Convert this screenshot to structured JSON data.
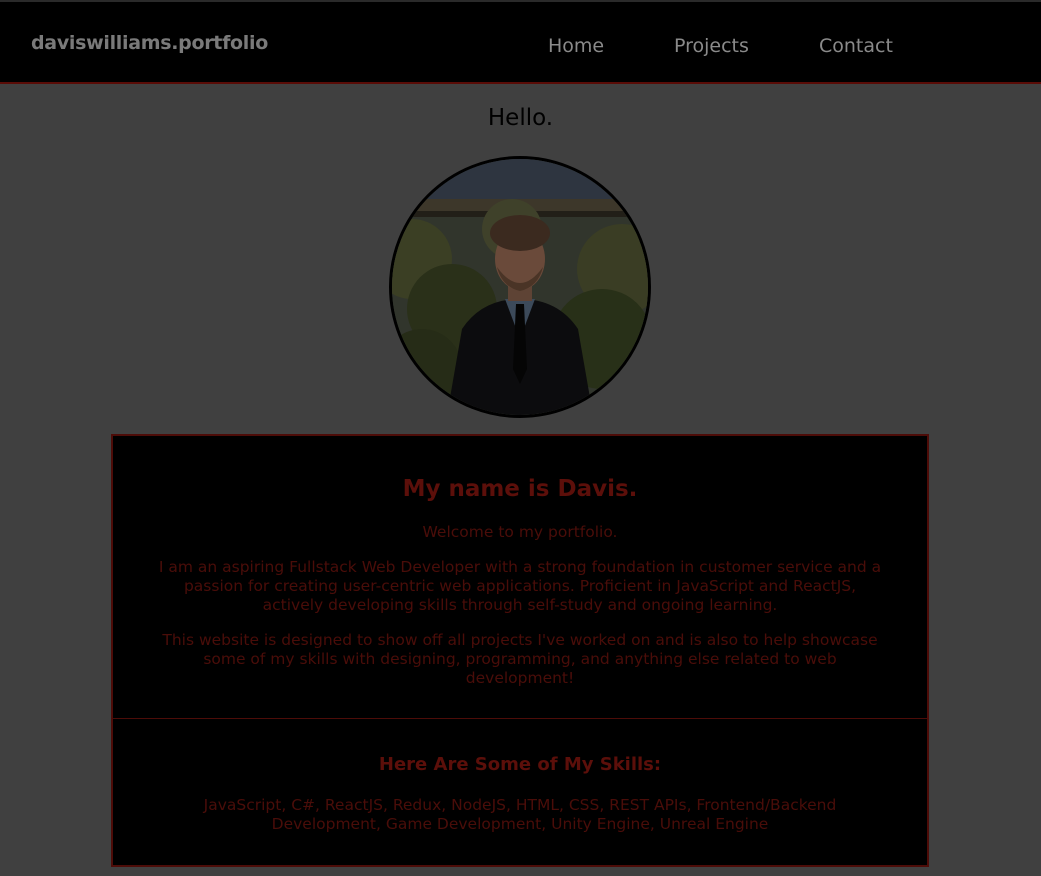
{
  "navbar": {
    "brand": "daviswilliams.portfolio",
    "links": [
      "Home",
      "Projects",
      "Contact"
    ]
  },
  "hero": {
    "greeting": "Hello."
  },
  "about": {
    "title": "My name is Davis.",
    "welcome": "Welcome to my portfolio.",
    "paragraph1": "I am an aspiring Fullstack Web Developer with a strong foundation in customer service and a passion for creating user-centric web applications. Proficient in JavaScript and ReactJS, actively developing skills through self-study and ongoing learning.",
    "paragraph2": "This website is designed to show off all projects I've worked on and is also to help showcase some of my skills with designing, programming, and anything else related to web development!"
  },
  "skills": {
    "title": "Here Are Some of My Skills:",
    "list": "JavaScript, C#, ReactJS, Redux, NodeJS, HTML, CSS, REST APIs, Frontend/Backend Development, Game Development, Unity Engine, Unreal Engine"
  },
  "colors": {
    "overlay_background": "#404040",
    "navbar_background": "#000000",
    "accent_dimmed": "#5c0f0a"
  }
}
